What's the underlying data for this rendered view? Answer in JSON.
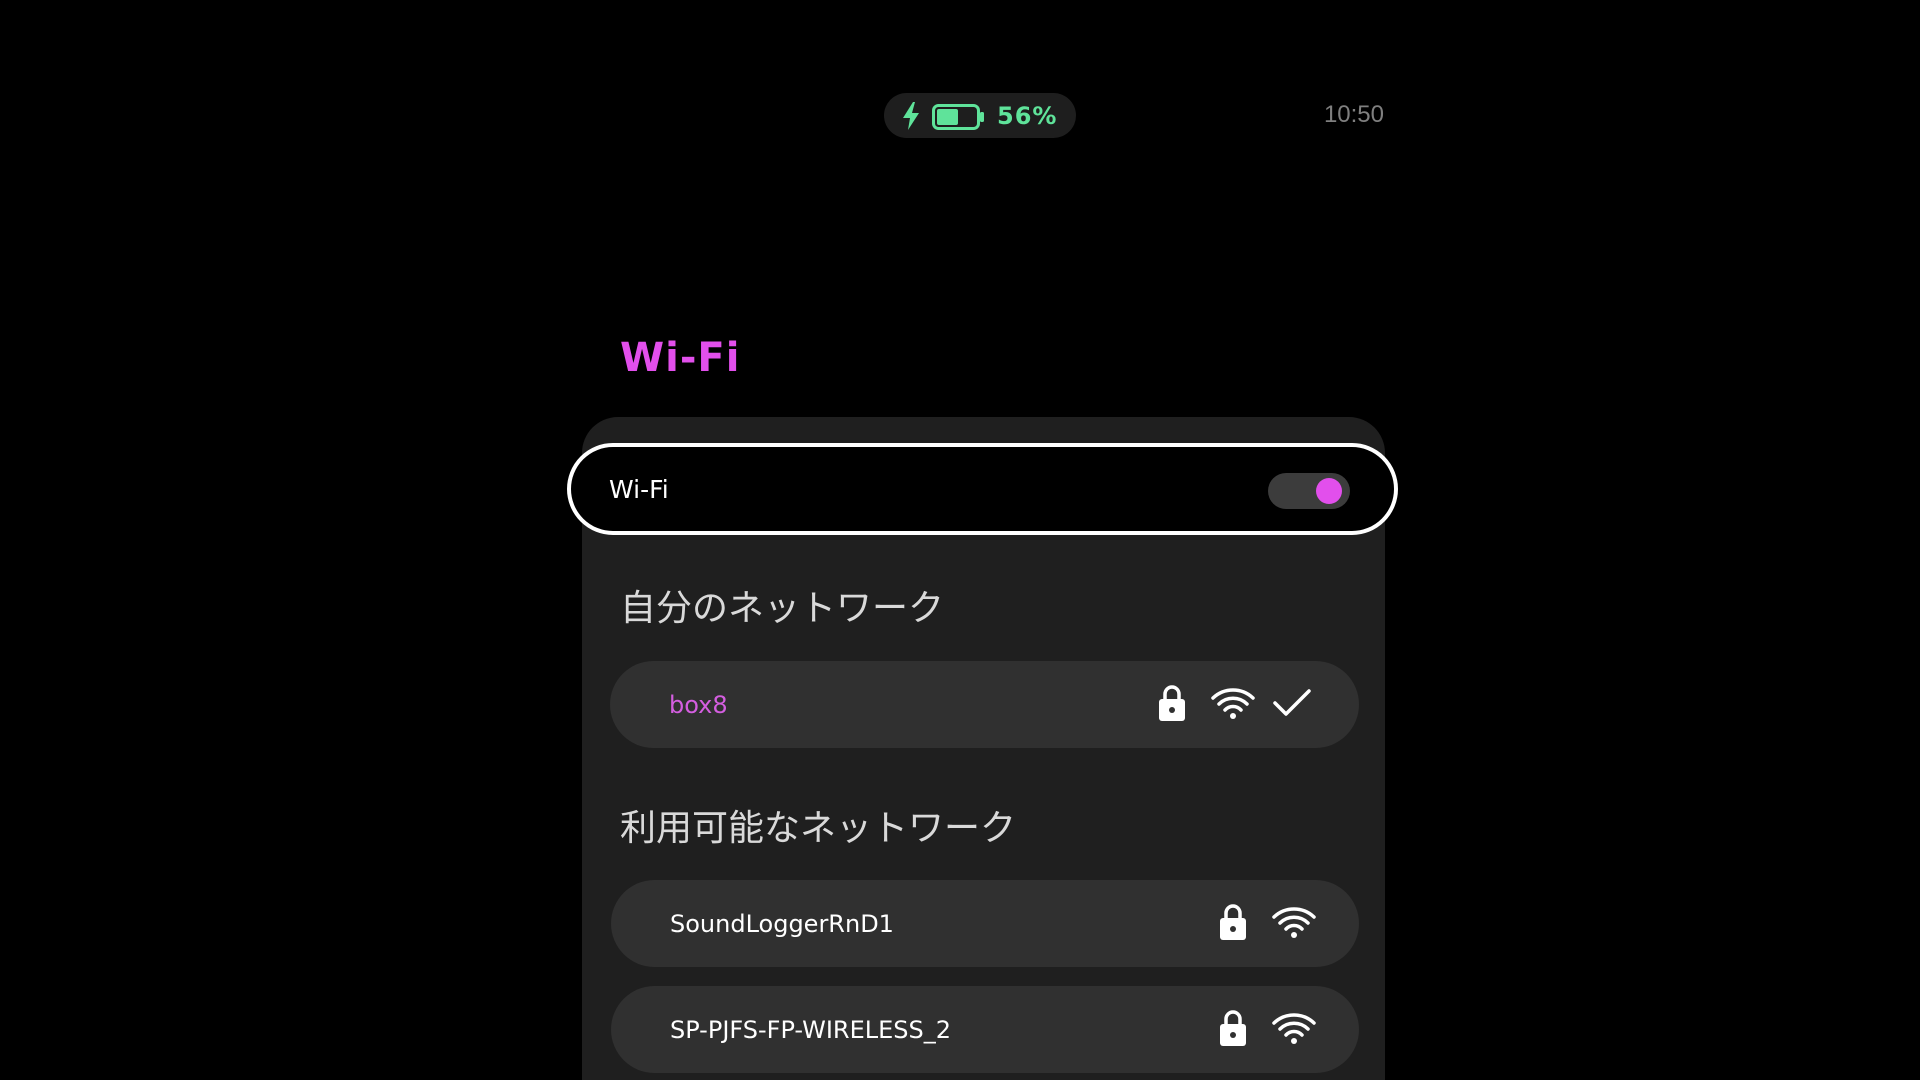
{
  "status_bar": {
    "battery_percent": "56%",
    "battery_level": 0.56,
    "charging": true,
    "time": "10:50"
  },
  "page": {
    "title": "Wi-Fi"
  },
  "wifi_toggle": {
    "label": "Wi-Fi",
    "enabled": true
  },
  "my_networks": {
    "header": "自分のネットワーク",
    "items": [
      {
        "name": "box8",
        "secured": true,
        "connected": true
      }
    ]
  },
  "available_networks": {
    "header": "利用可能なネットワーク",
    "items": [
      {
        "name": "SoundLoggerRnD1",
        "secured": true
      },
      {
        "name": "SP-PJFS-FP-WIRELESS_2",
        "secured": true
      }
    ]
  },
  "icons": {
    "charging": "bolt-icon",
    "battery": "battery-icon",
    "secured": "lock-icon",
    "signal": "wifi-icon",
    "connected": "check-icon"
  },
  "colors": {
    "accent": "#e24fec",
    "battery_green": "#5fe39a",
    "connected_text": "#d45ee0",
    "panel": "#1f1f1f",
    "row": "#303030"
  }
}
